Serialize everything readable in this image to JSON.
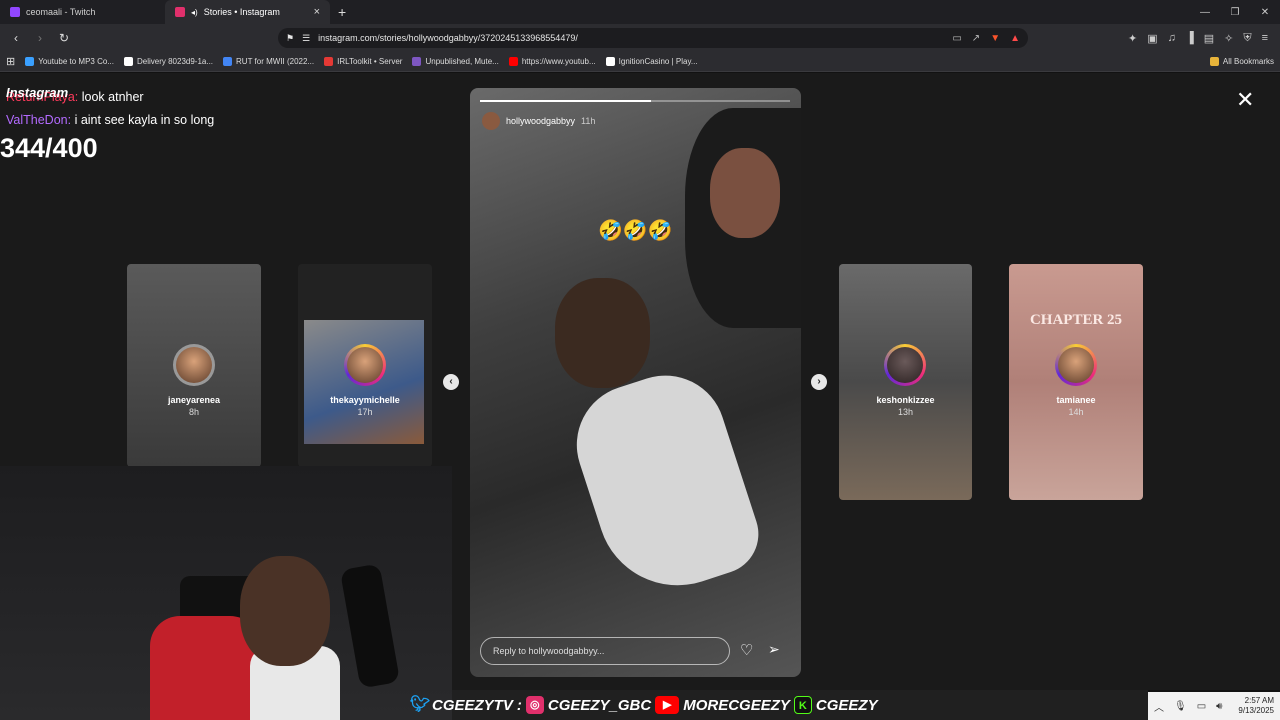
{
  "tabs": [
    {
      "label": "ceomaali - Twitch",
      "color": "#9146ff",
      "active": false
    },
    {
      "label": "Stories • Instagram",
      "color": "#e1306c",
      "active": true
    }
  ],
  "address": {
    "url": "instagram.com/stories/hollywoodgabbyy/3720245133968554479/"
  },
  "bookmarks": [
    {
      "label": "Youtube to MP3 Co...",
      "color": "#3aa0ff"
    },
    {
      "label": "Delivery 8023d9-1a...",
      "color": "#ffffff"
    },
    {
      "label": "RUT for MWII (2022...",
      "color": "#4285f4"
    },
    {
      "label": "IRLToolkit • Server",
      "color": "#e53935"
    },
    {
      "label": "Unpublished, Mute...",
      "color": "#7e57c2"
    },
    {
      "label": "https://www.youtub...",
      "color": "#ff0000"
    },
    {
      "label": "IgnitionCasino | Play...",
      "color": "#ffffff"
    }
  ],
  "bookmarks_all": "All Bookmarks",
  "overlay": {
    "brand": "Instagram",
    "chat": [
      {
        "user": "ReturnPlaya:",
        "msg": "look atnher"
      },
      {
        "user": "ValTheDon:",
        "msg": "i aint see kayla in so long"
      }
    ],
    "counter": "344/400"
  },
  "story": {
    "username": "hollywoodgabbyy",
    "time": "11h",
    "progress": 0.55,
    "emoji": "🤣🤣🤣",
    "reply_placeholder": "Reply to hollywoodgabbyy..."
  },
  "side_stories": [
    {
      "name": "janeyarenea",
      "time": "8h"
    },
    {
      "name": "thekayymichelle",
      "time": "17h"
    },
    {
      "name": "keshonkizzee",
      "time": "13h"
    },
    {
      "name": "tamianee",
      "time": "14h",
      "caption": "CHAPTER 25"
    }
  ],
  "socials": [
    {
      "handle": "CGEEZYTV",
      "icon": "twitter-icon",
      "color": "#1da1f2"
    },
    {
      "handle": "CGEEZY_GBC",
      "icon": "instagram-icon",
      "color": "#e1306c"
    },
    {
      "handle": "MORECGEEZY",
      "icon": "youtube-icon",
      "color": "#ff0000"
    },
    {
      "handle": "CGEEZY",
      "icon": "kick-icon",
      "color": "#53fc18"
    }
  ],
  "clock": {
    "time": "2:57 AM",
    "date": "9/13/2025"
  }
}
